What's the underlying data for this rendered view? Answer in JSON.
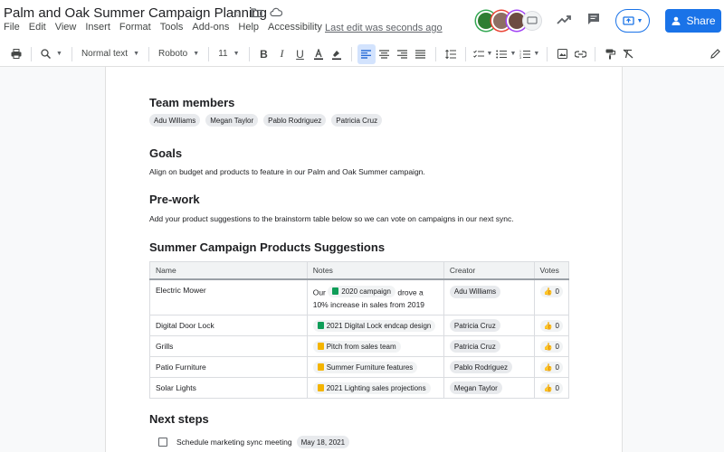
{
  "title": "Palm and Oak Summer Campaign Planning",
  "menu": [
    "File",
    "Edit",
    "View",
    "Insert",
    "Format",
    "Tools",
    "Add-ons",
    "Help",
    "Accessibility"
  ],
  "last_edit": "Last edit was seconds ago",
  "share_label": "Share",
  "toolbar": {
    "style": "Normal text",
    "font": "Roboto",
    "size": "11"
  },
  "doc": {
    "team_heading": "Team members",
    "team": [
      "Adu Williams",
      "Megan Taylor",
      "Pablo Rodriguez",
      "Patricia Cruz"
    ],
    "goals_heading": "Goals",
    "goals_text": "Align on budget and products to feature in our Palm and Oak Summer campaign.",
    "prework_heading": "Pre-work",
    "prework_text": "Add your product suggestions to the brainstorm table below so we can vote on campaigns in our next sync.",
    "table_heading": "Summer Campaign Products Suggestions",
    "columns": [
      "Name",
      "Notes",
      "Creator",
      "Votes"
    ],
    "rows": [
      {
        "name": "Electric Mower",
        "note_pre": "Our",
        "note_chip": "2020 campaign",
        "note_post": "drove a",
        "note_line2": "10% increase in sales from 2019",
        "creator": "Adu Williams",
        "votes": "0"
      },
      {
        "name": "Digital Door Lock",
        "note_chip": "2021 Digital Lock endcap design",
        "creator": "Patricia Cruz",
        "votes": "0"
      },
      {
        "name": "Grills",
        "note_chip": "Pitch from sales team",
        "creator": "Patricia Cruz",
        "votes": "0"
      },
      {
        "name": "Patio Furniture",
        "note_chip": "Summer Furniture features",
        "creator": "Pablo Rodriguez",
        "votes": "0"
      },
      {
        "name": "Solar Lights",
        "note_chip": "2021 Lighting sales projections",
        "creator": "Megan Taylor",
        "votes": "0"
      }
    ],
    "next_heading": "Next steps",
    "next_item": "Schedule marketing sync meeting",
    "next_date": "May 18, 2021"
  }
}
